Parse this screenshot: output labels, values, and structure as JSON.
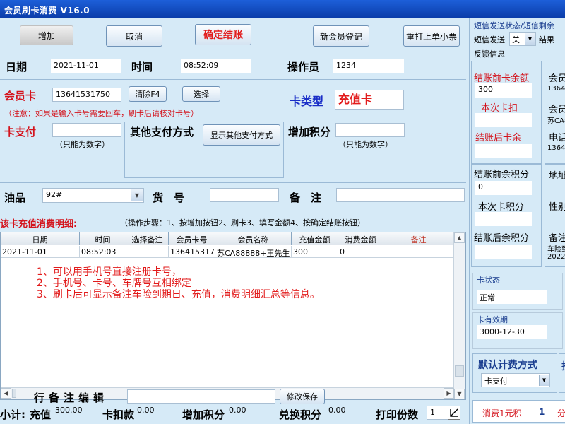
{
  "window": {
    "title": "会员刷卡消费 V16.0"
  },
  "toolbar": {
    "add": "增加",
    "cancel": "取消",
    "confirm": "确定结账",
    "new_member": "新会员登记",
    "reprint": "重打上单小票"
  },
  "header": {
    "date_label": "日期",
    "date_value": "2021-11-01",
    "time_label": "时间",
    "time_value": "08:52:09",
    "operator_label": "操作员",
    "operator_value": "1234"
  },
  "card": {
    "label": "会员卡",
    "value": "13641531750",
    "clear": "清除F4",
    "select": "选择",
    "type_label": "卡类型",
    "type_value": "充值卡",
    "notice": "（注意：如果是输入卡号需要回车，刷卡后请核对卡号）"
  },
  "payment": {
    "card_pay_label": "卡支付",
    "card_pay_value": "",
    "numbers_only": "（只能为数字）",
    "other_label": "其他支付方式",
    "show_other": "显示其他支付方式",
    "add_points_label": "增加积分",
    "add_points_value": "",
    "numbers_only2": "（只能为数字）"
  },
  "fuel": {
    "label": "油品",
    "value": "92#",
    "goods_label": "货　号",
    "goods_value": "",
    "remark_label": "备　注",
    "remark_value": ""
  },
  "detail": {
    "title": "该卡充值消费明细:",
    "steps": "（操作步骤：1、按增加按钮2、刷卡3、填写金额4、按确定结账按钮）",
    "columns": [
      "日期",
      "时间",
      "选择备注",
      "会员卡号",
      "会员名称",
      "充值金额",
      "消费金额",
      "备注"
    ],
    "rows": [
      [
        "2021-11-01",
        "08:52:03",
        "",
        "13641531750",
        "苏CA88888+王先生",
        "300",
        "0",
        ""
      ]
    ]
  },
  "notes": [
    "1、可以用手机号直接注册卡号，",
    "2、手机号、卡号、车牌号互相绑定",
    "3、刷卡后可显示备注车险到期日、充值，消费明细汇总等信息。"
  ],
  "row_remark": {
    "label": "行备注编辑",
    "value": "",
    "button": "修改保存"
  },
  "summary": {
    "label": "小计:",
    "recharge_label": "充值",
    "recharge_value": "300.00",
    "card_deduct_label": "卡扣款",
    "card_deduct_value": "0.00",
    "add_points_label": "增加积分",
    "add_points_value": "0.00",
    "exchange_label": "兑换积分",
    "exchange_value": "0.00",
    "print_label": "打印份数",
    "print_value": "1"
  },
  "sidebar": {
    "sms_status": "短信发送状态/短信剩余",
    "sms_send_label": "短信发送",
    "sms_send_value": "关",
    "result_label": "结果",
    "feedback_label": "反馈信息",
    "balance_before_label": "结账前卡余额",
    "balance_before_value": "300",
    "deduct_label": "本次卡扣",
    "deduct_value": "",
    "balance_after_label": "结账后卡余",
    "balance_after_value": "",
    "member_label": "会员",
    "member_value": "13641",
    "member2_label": "会员",
    "member2_value": "苏CA8",
    "phone_label": "电话",
    "phone_value": "13641",
    "points_before_label": "结账前余积分",
    "points_before_value": "0",
    "points_this_label": "本次卡积分",
    "points_this_value": "",
    "points_after_label": "结账后余积分",
    "points_after_value": "",
    "address_label": "地址",
    "gender_label": "性别",
    "remark_label": "备注",
    "remark_value1": "车险到",
    "remark_value2": "2022-",
    "card_status_label": "卡状态",
    "card_status_value": "正常",
    "card_expiry_label": "卡有效期",
    "card_expiry_value": "3000-12-30",
    "billing_label": "默认计费方式",
    "billing_value": "卡支付",
    "billing2_label": "折",
    "consumption_label": "消费1元积",
    "consumption_value": "1",
    "consumption_unit": "分"
  }
}
